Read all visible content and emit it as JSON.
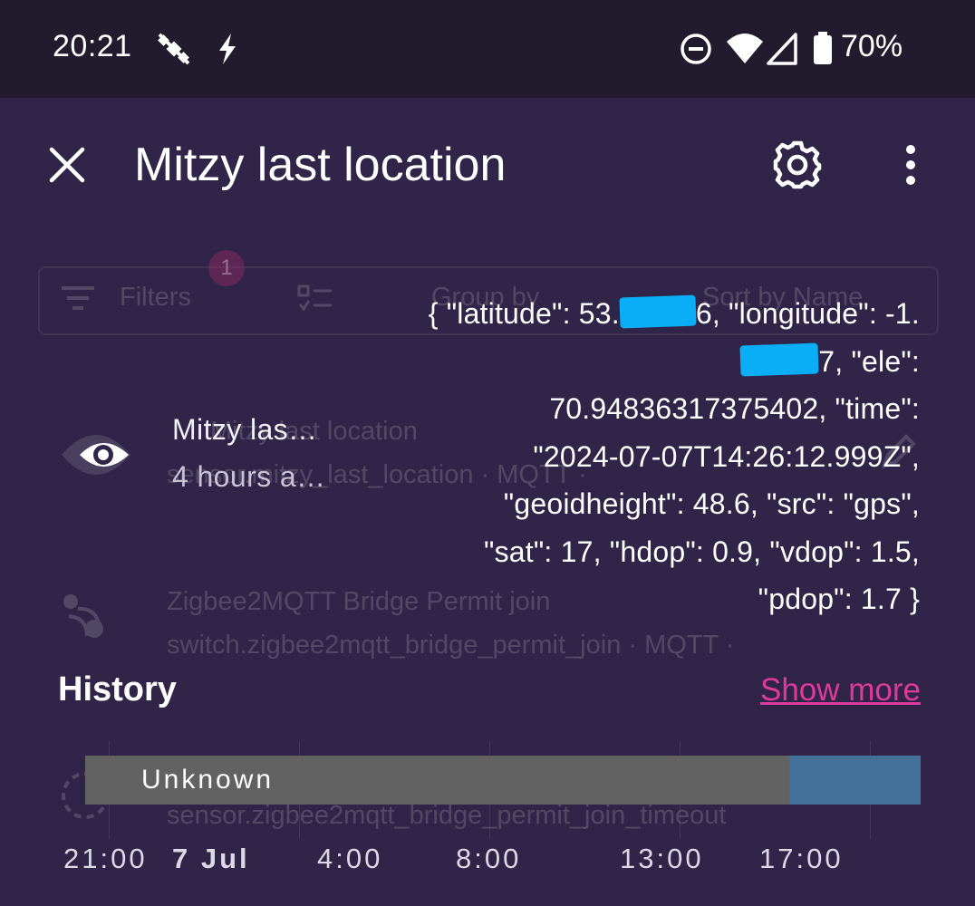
{
  "status_bar": {
    "time": "20:21",
    "battery_percent": "70%",
    "icons": [
      "satellite-off-icon",
      "flash-icon",
      "do-not-disturb-icon",
      "wifi-icon",
      "signal-icon",
      "battery-icon"
    ]
  },
  "background_page": {
    "filter_label": "Filters",
    "filter_badge": "1",
    "group_by": "Group by",
    "sort_by": "Sort by Name",
    "row1_name": "Mitzy last location",
    "row1_sub": "sensor.mitzy_last_location · MQTT ·",
    "row2_name": "Zigbee2MQTT Bridge Permit join",
    "row2_sub": "switch.zigbee2mqtt_bridge_permit_join · MQTT ·",
    "row3_sub": "sensor.zigbee2mqtt_bridge_permit_join_timeout"
  },
  "dialog": {
    "title": "Mitzy last location",
    "entity_name": "Mitzy las…",
    "entity_subtitle": "4 hours a…",
    "state": {
      "line1_a": "{ \"latitude\": 53.",
      "line1_b": "6, \"longitude\":",
      "line2_a": "-1.",
      "line2_b": "7, \"ele\":",
      "line3": "70.94836317375402, \"time\":",
      "line4": "\"2024-07-07T14:26:12.999Z\",",
      "line5": "\"geoidheight\": 48.6, \"src\": \"gps\",",
      "line6": "\"sat\": 17, \"hdop\": 0.9, \"vdop\": 1.5,",
      "line7": "\"pdop\": 1.7 }"
    },
    "history_label": "History",
    "show_more_label": "Show more",
    "timeline": {
      "segment_label": "Unknown",
      "unknown_fraction": 0.843,
      "colors": {
        "unknown": "#626262",
        "known": "#43709a"
      },
      "ticks": [
        "21:00",
        "7 Jul",
        "4:00",
        "8:00",
        "13:00",
        "17:00"
      ]
    }
  },
  "colors": {
    "dialog_bg": "#302548",
    "status_bar_bg": "#221b2d",
    "accent_link": "#e0399c"
  }
}
